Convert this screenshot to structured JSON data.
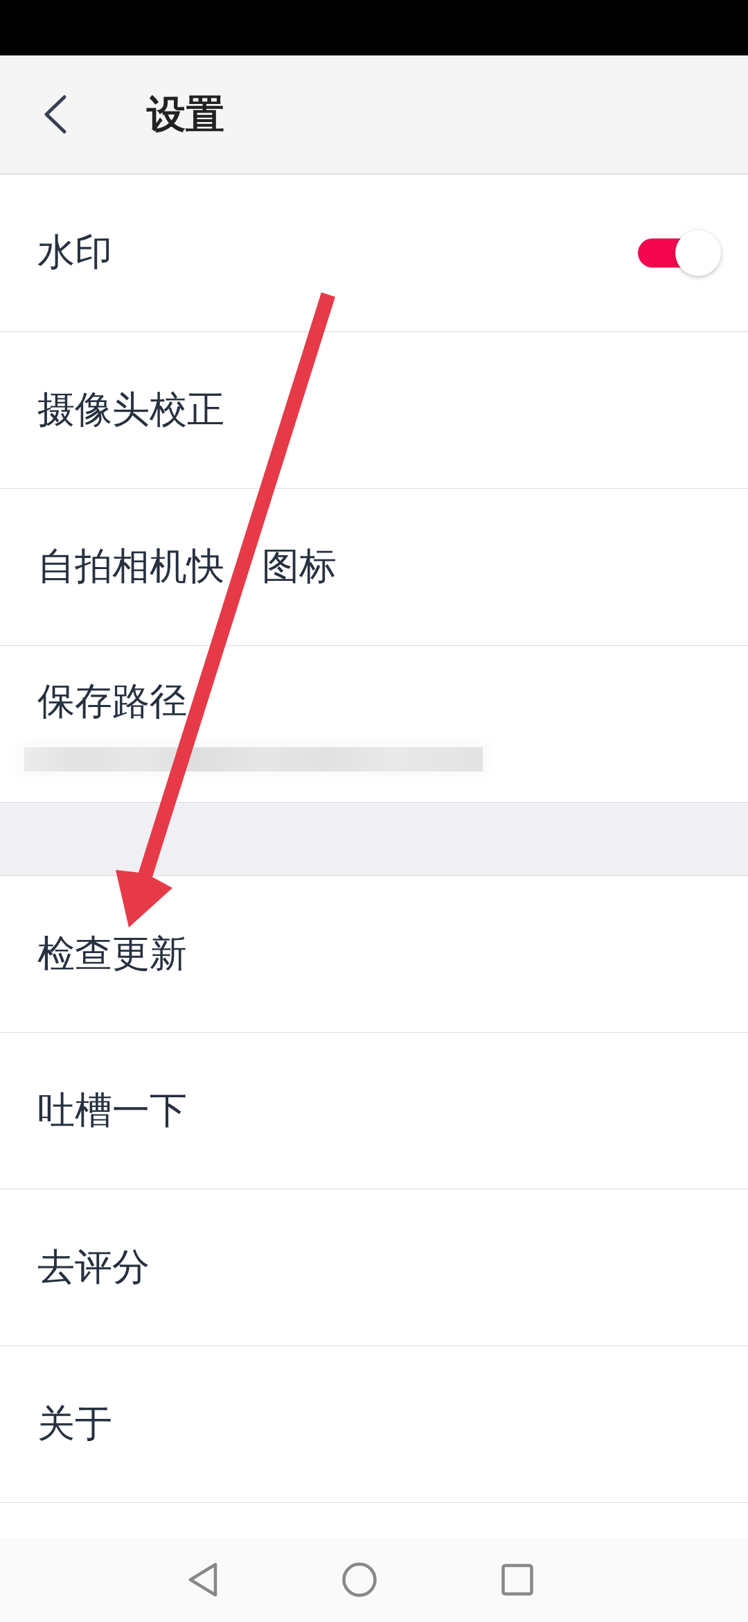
{
  "header": {
    "title": "设置"
  },
  "sections": [
    {
      "rows": [
        {
          "kind": "toggle",
          "label": "水印",
          "on": true
        },
        {
          "kind": "plain",
          "label": "摄像头校正"
        },
        {
          "kind": "split",
          "label_parts": [
            "自拍相机快",
            "图标"
          ]
        },
        {
          "kind": "path",
          "label": "保存路径"
        }
      ]
    },
    {
      "rows": [
        {
          "kind": "plain",
          "label": "检查更新"
        },
        {
          "kind": "plain",
          "label": "吐槽一下"
        },
        {
          "kind": "plain",
          "label": "去评分"
        },
        {
          "kind": "plain",
          "label": "关于"
        }
      ]
    }
  ]
}
